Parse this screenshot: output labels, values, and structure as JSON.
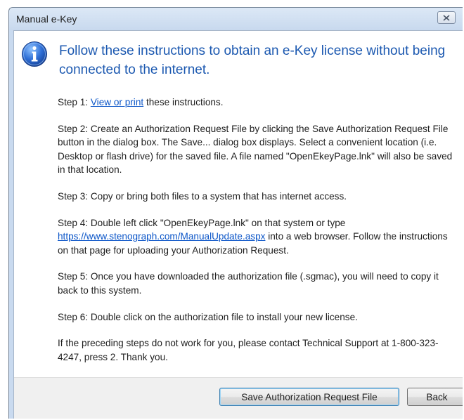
{
  "window": {
    "title": "Manual e-Key"
  },
  "heading": "Follow these instructions to obtain an e-Key license without being connected to the internet.",
  "steps": {
    "step1_prefix": "Step 1: ",
    "step1_link": "View or print",
    "step1_suffix": " these instructions.",
    "step2": "Step 2: Create an Authorization Request File by clicking the Save Authorization Request File button in the dialog box.  The Save... dialog box displays.  Select a convenient location (i.e. Desktop or flash drive) for the saved file.  A file named \"OpenEkeyPage.lnk\" will also be saved in that location.",
    "step3": "Step 3: Copy or bring both files to a system that has internet access.",
    "step4_prefix": "Step 4: Double left click \"OpenEkeyPage.lnk\" on that system or type ",
    "step4_link": "https://www.stenograph.com/ManualUpdate.aspx",
    "step4_suffix": " into a web browser.  Follow the instructions on that page for uploading your Authorization Request.",
    "step5": "Step 5: Once you have downloaded the authorization file (.sgmac), you will need to copy it back to this system.",
    "step6": "Step 6: Double click on the authorization file to install your new license.",
    "support": "If the preceding steps do not work for you, please contact Technical Support at 1-800-323-4247, press 2.  Thank you."
  },
  "buttons": {
    "save": "Save Authorization Request File",
    "back": "Back"
  },
  "icons": {
    "info": "info-icon",
    "close": "close-icon"
  },
  "colors": {
    "heading": "#1b58b0",
    "link": "#0c56c8",
    "title_bar": "#c9daef"
  }
}
